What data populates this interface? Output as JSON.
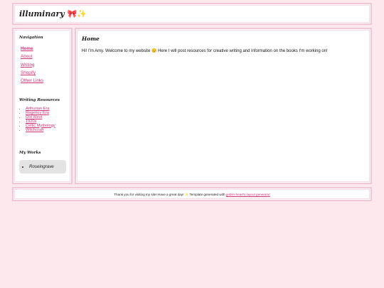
{
  "header": {
    "title": "illuminary",
    "title_emoji_bow": "🎀",
    "title_emoji_sparkles": "✨"
  },
  "sidebar": {
    "nav_heading": "Navigation",
    "nav_items": [
      {
        "label": "Home",
        "active": true
      },
      {
        "label": "About"
      },
      {
        "label": "Writing"
      },
      {
        "label": "Shopify"
      },
      {
        "label": "Other Links"
      }
    ],
    "resources_heading": "Writing Resources",
    "resources": [
      {
        "label": "Arthurian Era"
      },
      {
        "label": "Regency Era"
      },
      {
        "label": "Old West"
      },
      {
        "label": "1920s"
      },
      {
        "label": "Celtic Mythology"
      },
      {
        "label": "Witchcraft"
      }
    ],
    "works_heading": "My Works",
    "works": [
      {
        "label": "Roseingrave"
      }
    ]
  },
  "main": {
    "heading": "Home",
    "intro": "Hi! I'm Amy. Welcome to my website 😊 Here I will post resources for creative writing and information on the books I'm working on!"
  },
  "footer": {
    "text_before": "Thank you for visiting my site! Have a great day! ✨ Template generated with ",
    "link_label": "goblin-heart's layout generator"
  },
  "colors": {
    "background": "#fde8ee",
    "border": "#f1c6d6",
    "link": "#d4317c",
    "works_box": "#e3e3e3"
  }
}
